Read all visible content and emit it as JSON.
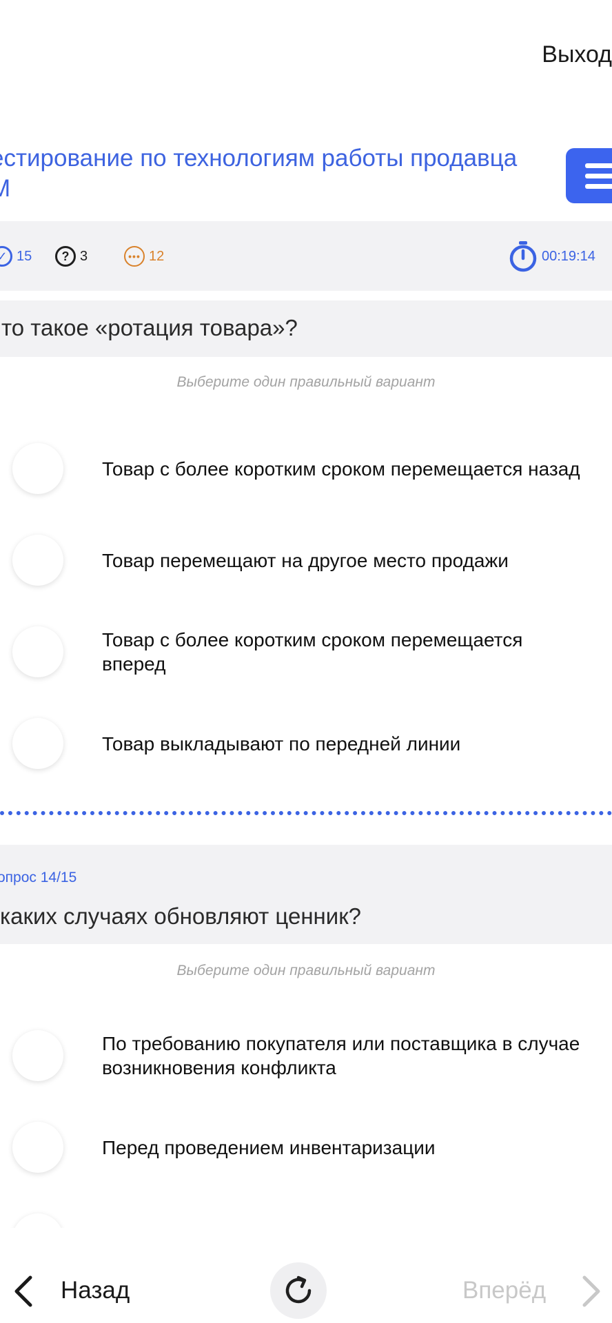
{
  "header": {
    "exit_label": "Выход"
  },
  "test": {
    "title": "естирование по технологиям работы продавца\nМ"
  },
  "stats": {
    "answered": "15",
    "unanswered": "3",
    "remaining": "12",
    "timer": "00:19:14"
  },
  "questions": [
    {
      "text": "то такое «ротация товара»?",
      "hint": "Выберите один правильный вариант",
      "options": [
        "Товар с более коротким сроком перемещается назад",
        "Товар перемещают на другое место продажи",
        "Товар с более коротким сроком перемещается\nвперед",
        "Товар выкладывают по передней линии"
      ]
    },
    {
      "number": "опрос 14/15",
      "text": " каких случаях обновляют ценник?",
      "hint": "Выберите один правильный вариант",
      "options": [
        "По требованию покупателя или поставщика в случае\nвозникновения конфликта",
        "Перед проведением инвентаризации"
      ]
    }
  ],
  "nav": {
    "back_label": "Назад",
    "forward_label": "Вперёд"
  },
  "colors": {
    "accent": "#3c64ee",
    "warning": "#d9822b",
    "hint": "#a3a3a3",
    "band": "#f2f2f4"
  }
}
